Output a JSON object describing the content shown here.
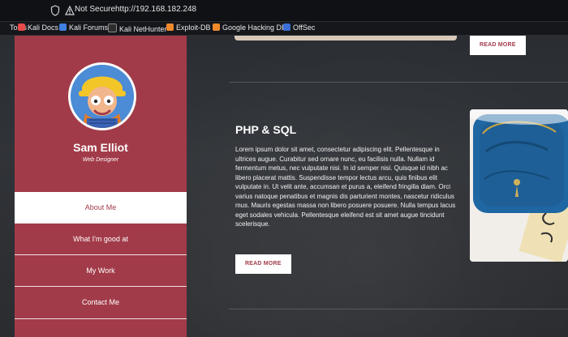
{
  "browser": {
    "not_secure_label": "Not Secure",
    "url": "http://192.168.182.248",
    "bookmarks": [
      {
        "label": "Tools",
        "icon": "tools-icon"
      },
      {
        "label": "Kali Docs",
        "icon": "kali-docs-icon"
      },
      {
        "label": "Kali Forums",
        "icon": "kali-forums-icon"
      },
      {
        "label": "Kali NetHunter",
        "icon": "kali-nethunter-icon"
      },
      {
        "label": "Exploit-DB",
        "icon": "exploit-db-icon"
      },
      {
        "label": "Google Hacking DB",
        "icon": "google-hacking-db-icon"
      },
      {
        "label": "OffSec",
        "icon": "offsec-icon"
      }
    ]
  },
  "sidebar": {
    "name": "Sam Elliot",
    "role": "Web Designer",
    "nav": [
      {
        "label": "About Me",
        "active": true
      },
      {
        "label": "What I'm good at",
        "active": false
      },
      {
        "label": "My Work",
        "active": false
      },
      {
        "label": "Contact Me",
        "active": false
      }
    ]
  },
  "content": {
    "top_read_more": "READ MORE",
    "section_title": "PHP & SQL",
    "section_body": "Lorem ipsum dolor sit amet, consectetur adipiscing elit. Pellentesque in ultrices augue. Curabitur sed ornare nunc, eu facilisis nulla. Nullam id fermentum metus, nec vulputate nisi. In id semper nisi. Quisque id nibh ac libero placerat mattis. Suspendisse tempor lectus arcu, quis finibus elit vulputate in. Ut velit ante, accumsan et purus a, eleifend fringilla diam. Orci varius natoque penatibus et magnis dis parturient montes, nascetur ridiculus mus. Mauris egestas massa non libero posuere posuere. Nulla tempus lacus eget sodales vehicula. Pellentesque eleifend est sit amet augue tincidunt scelerisque.",
    "section_read_more": "READ MORE"
  },
  "colors": {
    "accent": "#a23b49",
    "background": "#2d3034"
  }
}
